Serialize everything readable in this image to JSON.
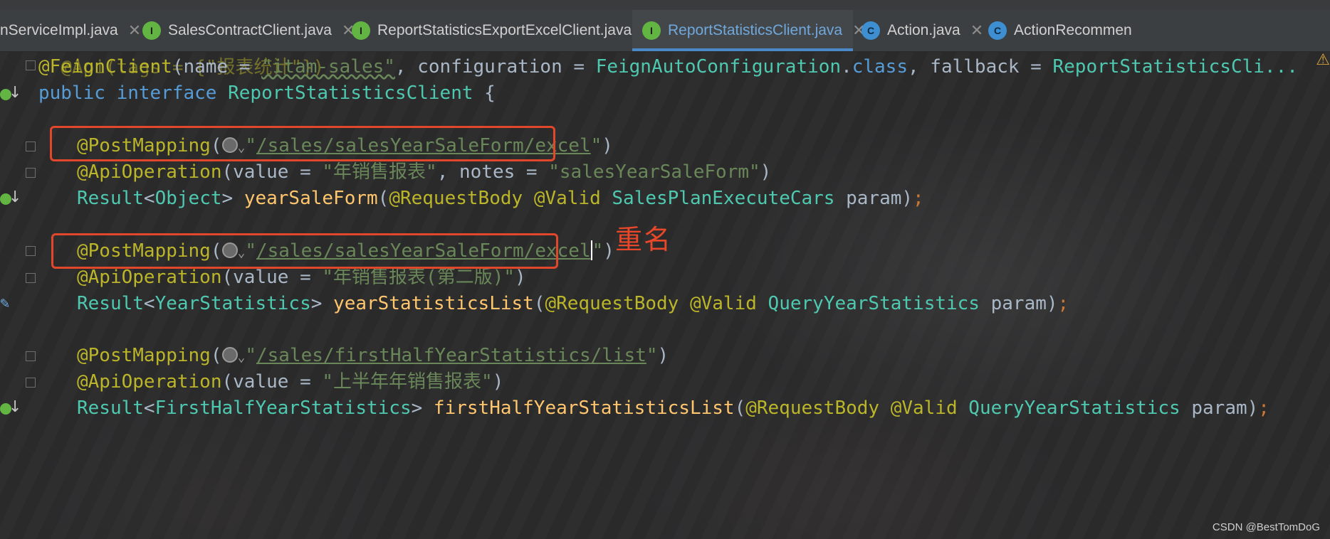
{
  "tabs": [
    {
      "label": "nServiceImpl.java",
      "icon": "class-icon",
      "active": false
    },
    {
      "label": "SalesContractClient.java",
      "icon": "interface-icon",
      "active": false
    },
    {
      "label": "ReportStatisticsExportExcelClient.java",
      "icon": "interface-icon",
      "active": false
    },
    {
      "label": "ReportStatisticsClient.java",
      "icon": "interface-icon",
      "active": true
    },
    {
      "label": "Action.java",
      "icon": "class-icon",
      "active": false
    },
    {
      "label": "ActionRecommen",
      "icon": "class-icon",
      "active": false
    }
  ],
  "tab_icon_letters": {
    "interface": "I",
    "class": "C"
  },
  "code": {
    "l0": "@Api(tags = {\"报表统计\"})",
    "l1_ann": "@FeignClient",
    "l1_a": "(name = ",
    "l1_name": "\"itam-sales\"",
    "l1_b": ", configuration = ",
    "l1_cfg": "FeignAutoConfiguration",
    "l1_c": ".",
    "l1_kw": "class",
    "l1_d": ", fallback = ",
    "l1_fb": "ReportStatisticsCli...",
    "l2_kw1": "public",
    "l2_kw2": "interface",
    "l2_name": "ReportStatisticsClient",
    "l2_brace": " {",
    "m1_ann": "@PostMapping",
    "m1_url": "/sales/salesYearSaleForm/excel",
    "m1_op_ann": "@ApiOperation",
    "m1_op_a": "(value = ",
    "m1_op_val": "\"年销售报表\"",
    "m1_op_b": ", notes = ",
    "m1_op_notes": "\"salesYearSaleForm\"",
    "m1_ret": "Result",
    "m1_gen": "Object",
    "m1_fn": "yearSaleForm",
    "m1_p1": "@RequestBody",
    "m1_p2": "@Valid",
    "m1_ptype": "SalesPlanExecuteCars",
    "m1_pname": " param)",
    "m2_ann": "@PostMapping",
    "m2_url": "/sales/salesYearSaleForm/excel",
    "m2_op_ann": "@ApiOperation",
    "m2_op_a": "(value = ",
    "m2_op_val": "\"年销售报表(第二版)\"",
    "m2_ret": "Result",
    "m2_gen": "YearStatistics",
    "m2_fn": "yearStatisticsList",
    "m2_p1": "@RequestBody",
    "m2_p2": "@Valid",
    "m2_ptype": "QueryYearStatistics",
    "m2_pname": " param)",
    "m3_ann": "@PostMapping",
    "m3_url": "/sales/firstHalfYearStatistics/list",
    "m3_op_ann": "@ApiOperation",
    "m3_op_a": "(value = ",
    "m3_op_val": "\"上半年年销售报表\"",
    "m3_ret": "Result",
    "m3_gen": "FirstHalfYearStatistics",
    "m3_fn": "firstHalfYearStatisticsList",
    "m3_p1": "@RequestBody",
    "m3_p2": "@Valid",
    "m3_ptype": "QueryYearStatistics",
    "m3_pname": " param)"
  },
  "annotation_note": "重名",
  "watermark": "CSDN @BestTomDoG",
  "colors": {
    "highlight_box": "#e0472b",
    "active_tab_text": "#6fa8dc"
  }
}
